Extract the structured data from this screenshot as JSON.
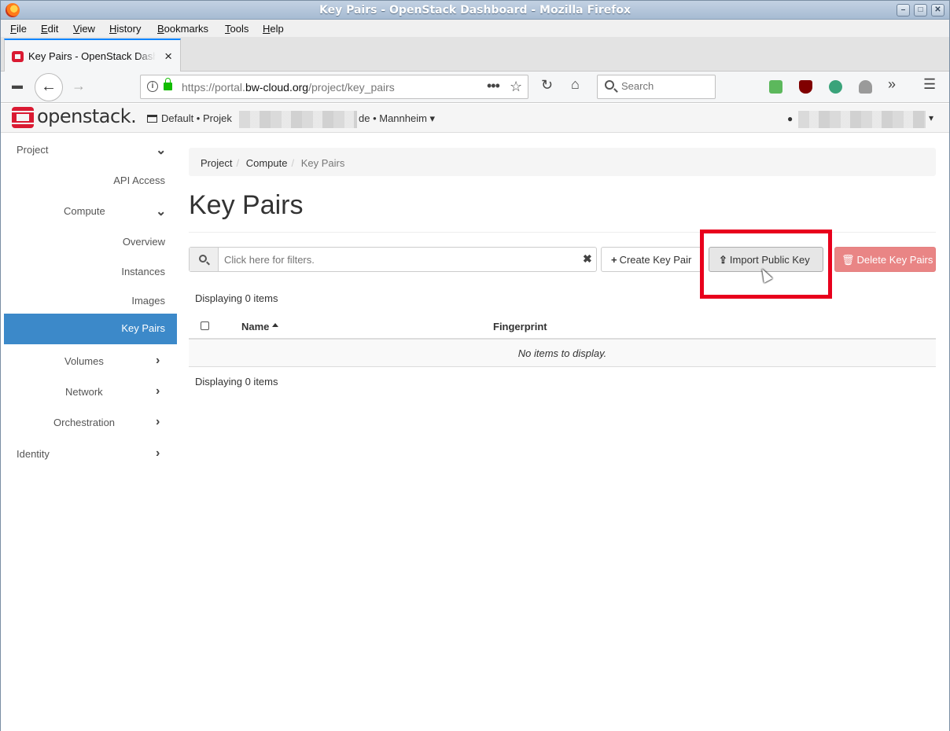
{
  "window": {
    "title": "Key Pairs - OpenStack Dashboard - Mozilla Firefox"
  },
  "menu": [
    "File",
    "Edit",
    "View",
    "History",
    "Bookmarks",
    "Tools",
    "Help"
  ],
  "tab": {
    "title": "Key Pairs - OpenStack Dashboard",
    "close": "×"
  },
  "urlbar": {
    "url_prefix": "https://portal.",
    "url_domain": "bw-cloud.org",
    "url_path": "/project/key_pairs"
  },
  "searchbar": {
    "placeholder": "Search"
  },
  "header": {
    "logo_text": "openstack.",
    "context_left": "Default • Projek",
    "context_right": "de • Mannheim ▾",
    "user_caret": "▾"
  },
  "sidebar": {
    "items": [
      {
        "label": "Project",
        "chevron": "⌄"
      },
      {
        "label": "API Access"
      },
      {
        "label": "Compute",
        "chevron": "⌄"
      },
      {
        "label": "Overview"
      },
      {
        "label": "Instances"
      },
      {
        "label": "Images"
      },
      {
        "label": "Key Pairs"
      },
      {
        "label": "Volumes",
        "chevron": "›"
      },
      {
        "label": "Network",
        "chevron": "›"
      },
      {
        "label": "Orchestration",
        "chevron": "›"
      },
      {
        "label": "Identity",
        "chevron": "›"
      }
    ]
  },
  "breadcrumb": [
    "Project",
    "Compute",
    "Key Pairs"
  ],
  "page_title": "Key Pairs",
  "filter": {
    "placeholder": "Click here for filters.",
    "clear": "✖"
  },
  "buttons": {
    "create": "Create Key Pair",
    "import": "Import Public Key",
    "delete": "Delete Key Pairs"
  },
  "table": {
    "count_text": "Displaying 0 items",
    "columns": [
      "Name",
      "Fingerprint"
    ],
    "empty_text": "No items to display."
  },
  "colors": {
    "accent": "#3c89c9",
    "highlight": "#e8001c",
    "danger": "#e98585",
    "logo": "#da1a32"
  }
}
